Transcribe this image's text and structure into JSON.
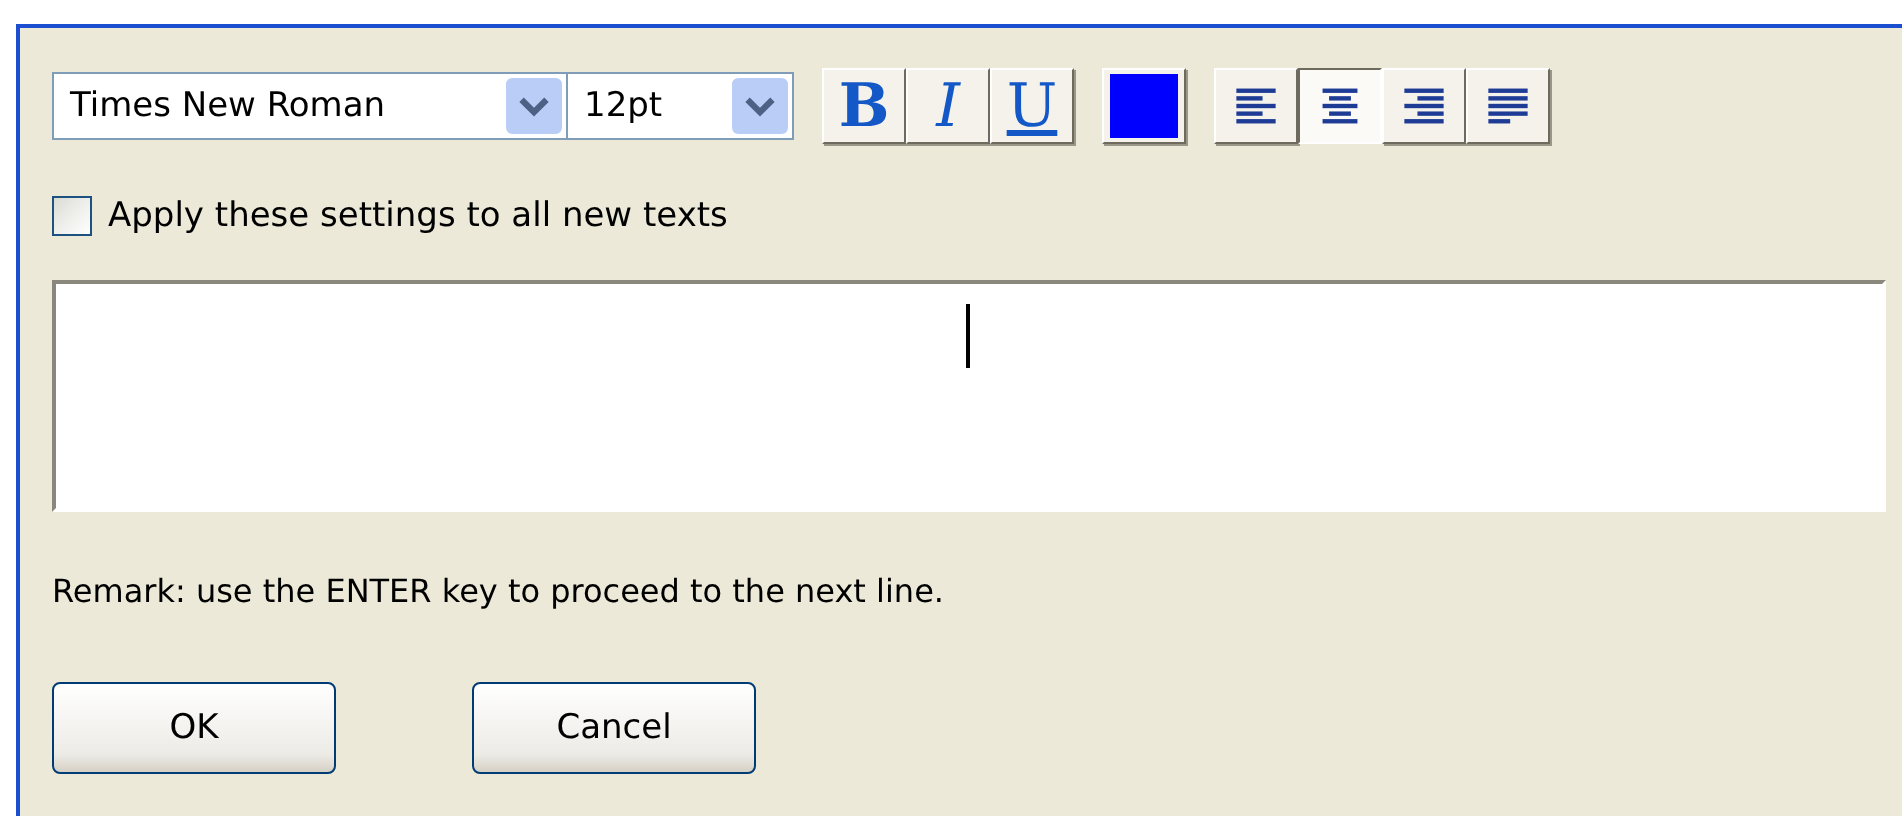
{
  "toolbar": {
    "font": {
      "value": "Times New Roman"
    },
    "size": {
      "value": "12pt"
    },
    "styles": [
      {
        "label": "B",
        "kind": "bold",
        "selected": false
      },
      {
        "label": "I",
        "kind": "italic",
        "selected": false
      },
      {
        "label": "U",
        "kind": "underline",
        "selected": false
      }
    ],
    "text_color": {
      "color": "#0000ff"
    },
    "alignments": [
      {
        "kind": "left",
        "selected": false
      },
      {
        "kind": "center",
        "selected": true
      },
      {
        "kind": "right",
        "selected": false
      },
      {
        "kind": "justify",
        "selected": false
      }
    ]
  },
  "apply_all": {
    "label": "Apply these settings to all new texts",
    "checked": false
  },
  "remark": "Remark: use the ENTER key to proceed to the next line.",
  "buttons": [
    {
      "label": "OK"
    },
    {
      "label": "Cancel"
    }
  ]
}
